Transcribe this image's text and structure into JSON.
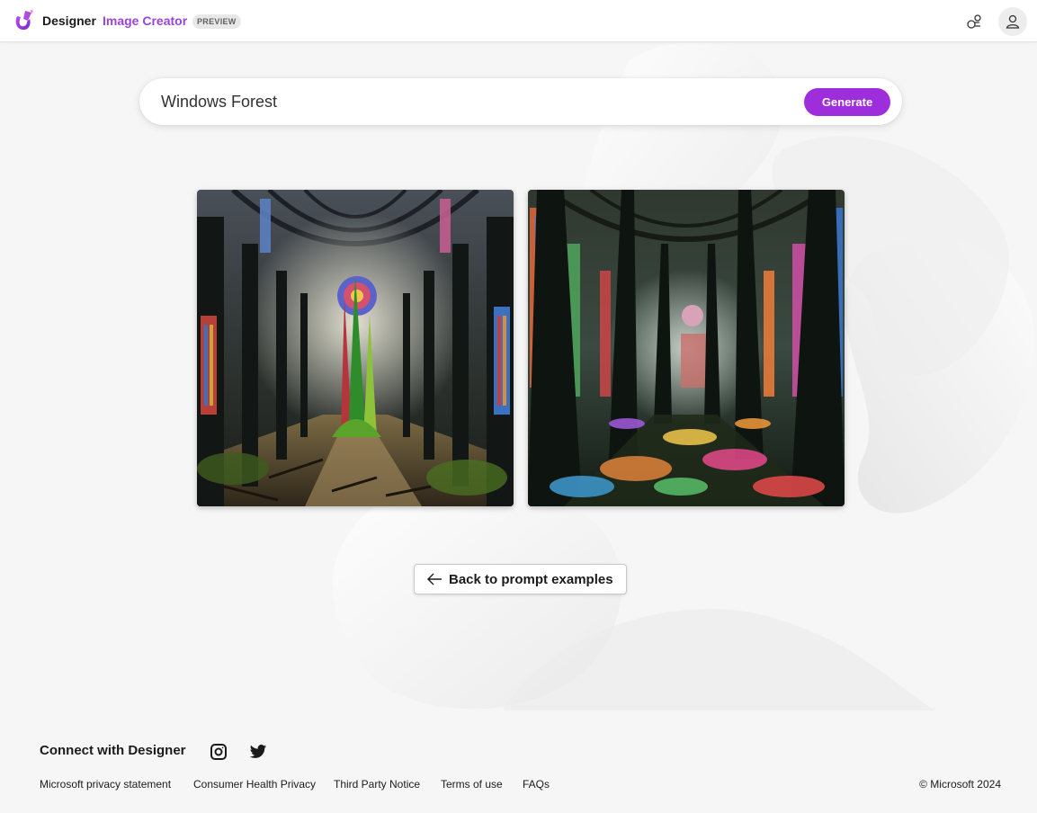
{
  "header": {
    "brand": "Designer",
    "product": "Image Creator",
    "badge": "PREVIEW",
    "icons": [
      "designer-logo-icon",
      "rewards-icon",
      "profile-icon"
    ]
  },
  "search": {
    "value": "Windows Forest",
    "generate_label": "Generate"
  },
  "results": [
    {
      "description_icon": "cathedral-forest-image"
    },
    {
      "description_icon": "stained-glass-forest-image"
    }
  ],
  "back_button": {
    "label": "Back to prompt examples",
    "icon": "arrow-left-icon"
  },
  "footer": {
    "connect_title": "Connect with Designer",
    "social_icons": [
      "instagram-icon",
      "twitter-icon"
    ],
    "links": [
      "Microsoft privacy statement",
      "Consumer Health Privacy",
      "Third Party Notice",
      "Terms of use",
      "FAQs"
    ],
    "copyright": "© Microsoft 2024"
  },
  "colors": {
    "accent": "#9e2edc",
    "product_text": "#9b44d8",
    "background": "#f6f6f6"
  }
}
